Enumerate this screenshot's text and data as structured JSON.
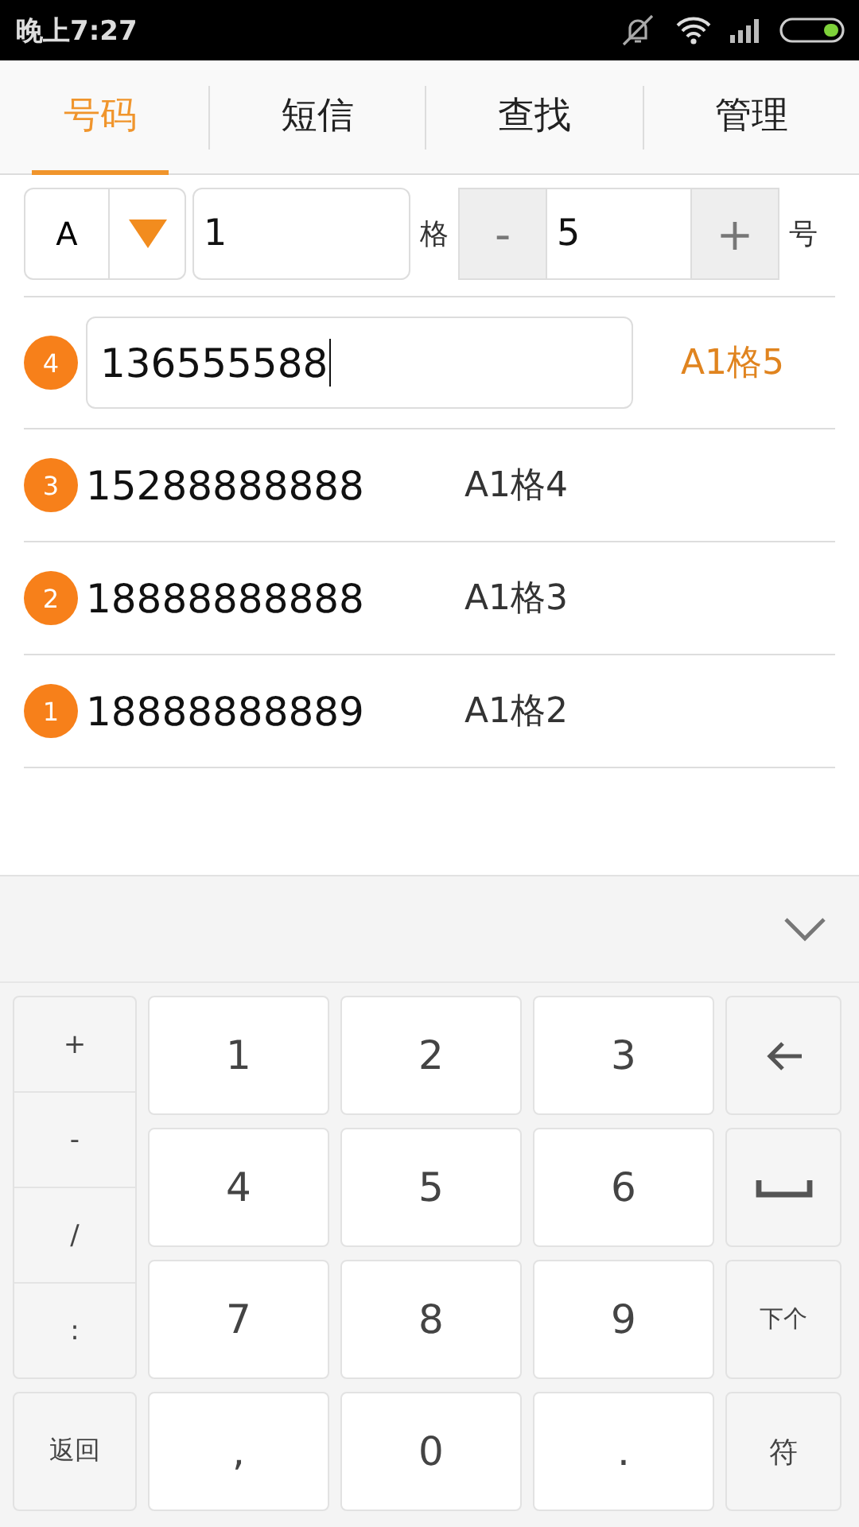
{
  "status_bar": {
    "time": "晚上7:27"
  },
  "tabs": [
    {
      "label": "号码",
      "selected": true
    },
    {
      "label": "短信",
      "selected": false
    },
    {
      "label": "查找",
      "selected": false
    },
    {
      "label": "管理",
      "selected": false
    }
  ],
  "controls": {
    "letter": "A",
    "cell_value": "1",
    "cell_label": "格",
    "minus": "-",
    "number_value": "5",
    "plus": "+",
    "number_label": "号"
  },
  "entries": [
    {
      "badge": "4",
      "number": "136555588",
      "location": "A1格5",
      "editing": true
    },
    {
      "badge": "3",
      "number": "15288888888",
      "location": "A1格4",
      "editing": false
    },
    {
      "badge": "2",
      "number": "18888888888",
      "location": "A1格3",
      "editing": false
    },
    {
      "badge": "1",
      "number": "18888888889",
      "location": "A1格2",
      "editing": false
    }
  ],
  "keyboard": {
    "side_keys": [
      "+",
      "-",
      "/",
      ":"
    ],
    "back_key": "返回",
    "keys": [
      {
        "kind": "digit",
        "label": "1"
      },
      {
        "kind": "digit",
        "label": "2"
      },
      {
        "kind": "digit",
        "label": "3"
      },
      {
        "kind": "backspace"
      },
      {
        "kind": "digit",
        "label": "4"
      },
      {
        "kind": "digit",
        "label": "5"
      },
      {
        "kind": "digit",
        "label": "6"
      },
      {
        "kind": "space"
      },
      {
        "kind": "digit",
        "label": "7"
      },
      {
        "kind": "digit",
        "label": "8"
      },
      {
        "kind": "digit",
        "label": "9"
      },
      {
        "kind": "function",
        "label": "下个"
      },
      {
        "kind": "digit",
        "label": ","
      },
      {
        "kind": "digit",
        "label": "0"
      },
      {
        "kind": "digit",
        "label": "."
      },
      {
        "kind": "function",
        "label": "符"
      }
    ]
  }
}
